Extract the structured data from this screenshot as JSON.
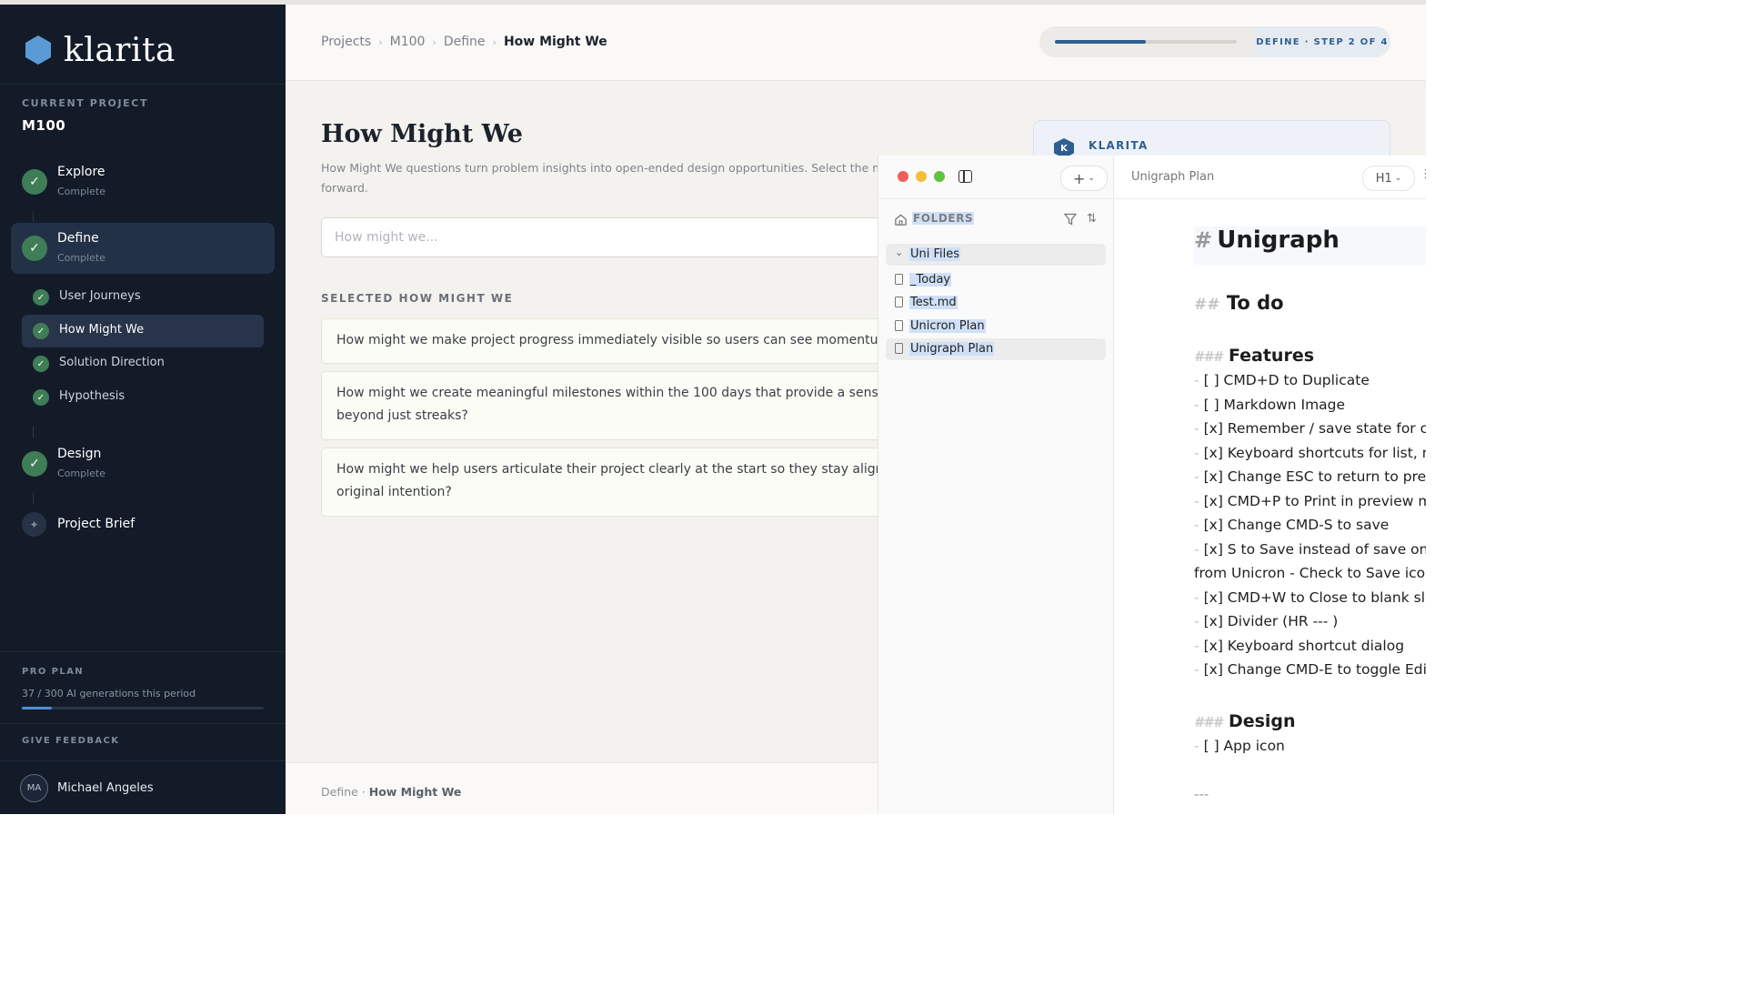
{
  "brand": {
    "name": "klarita",
    "color": "#5b9bd5"
  },
  "sidebar": {
    "current_project_label": "CURRENT PROJECT",
    "current_project": "M100",
    "stages": [
      {
        "name": "Explore",
        "status": "Complete"
      },
      {
        "name": "Define",
        "status": "Complete"
      },
      {
        "name": "Design",
        "status": "Complete"
      }
    ],
    "define_steps": [
      "User Journeys",
      "How Might We",
      "Solution Direction",
      "Hypothesis"
    ],
    "brief": "Project Brief",
    "brief_icon": "sparkle-icon",
    "plan_label": "PRO PLAN",
    "plan_usage": "37 / 300 AI generations this period",
    "plan_usage_fraction": 0.123,
    "feedback_label": "GIVE FEEDBACK",
    "user_initials": "MA",
    "user_name": "Michael Angeles"
  },
  "topbar": {
    "breadcrumbs": [
      "Projects",
      "M100",
      "Define"
    ],
    "breadcrumb_current": "How Might We",
    "step_label": "DEFINE · STEP 2 OF 4",
    "step_progress": 0.5
  },
  "main": {
    "title": "How Might We",
    "description": "How Might We questions turn problem insights into open-ended design opportunities. Select the most prom",
    "description_line2": "forward.",
    "input_placeholder": "How might we...",
    "selected_label": "SELECTED HOW MIGHT WE",
    "selected": [
      [
        "How might we make project progress immediately visible so users can see momentum from"
      ],
      [
        "How might we create meaningful milestones within the 100 days that provide a sense of ach",
        "beyond just streaks?"
      ],
      [
        "How might we help users articulate their project clearly at the start so they stay aligned with",
        "original intention?"
      ]
    ],
    "assistant_tab": "KLARITA",
    "assistant_initial": "K"
  },
  "footer": {
    "stage": "Define",
    "page": "How Might We"
  },
  "editor": {
    "folders_label": "FOLDERS",
    "folder": "Uni Files",
    "files": [
      "_Today",
      "Test.md",
      "Unicron Plan",
      "Unigraph Plan"
    ],
    "active_file": "Unigraph Plan",
    "doc_title": "Unigraph Plan",
    "heading_level": "H1",
    "doc": {
      "h1_hash": "#",
      "h1": "Unigraph",
      "h2_hash": "##",
      "h2": "To do",
      "h3_hash": "###",
      "features_heading": "Features",
      "features": [
        "[ ] CMD+D to Duplicate",
        "[ ] Markdown Image",
        "[x] Remember / save state for colla",
        "[x] Keyboard shortcuts for list, num",
        "[x] Change ESC to return to previe",
        "[x] CMD+P to Print in preview mod",
        "[x] Change CMD-S to save",
        "[x] S to Save instead of save on blu"
      ],
      "wrapped_line": "from Unicron - Check to Save icon?",
      "features_more": [
        "[x] CMD+W to Close to blank slate",
        "[x] Divider (HR --- )",
        "[x] Keyboard shortcut dialog",
        "[x] Change CMD-E to toggle Edit/P"
      ],
      "design_heading": "Design",
      "design": [
        "[ ] App icon"
      ],
      "hr": "---"
    }
  },
  "colors": {
    "sidebar_bg": "#131b28",
    "check_green": "#3f7d57",
    "accent_blue": "#2f5f92",
    "selection": "#cfe0f7",
    "traffic_red": "#ee5f57",
    "traffic_yellow": "#f5bd3a",
    "traffic_green": "#5fc53f"
  }
}
